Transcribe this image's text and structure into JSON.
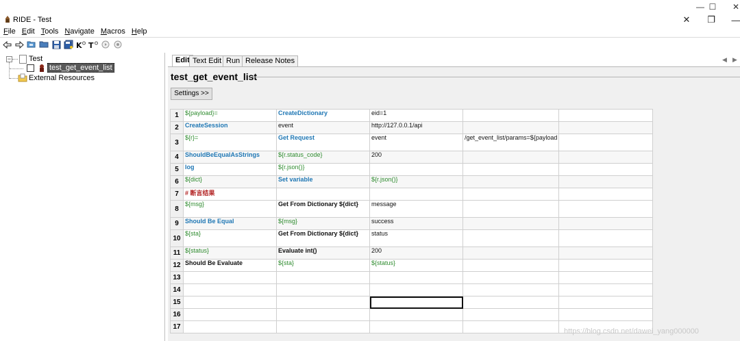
{
  "window": {
    "title": "RIDE - Test"
  },
  "menu": [
    {
      "key": "F",
      "rest": "ile"
    },
    {
      "key": "E",
      "rest": "dit"
    },
    {
      "key": "T",
      "rest": "ools"
    },
    {
      "key": "N",
      "rest": "avigate"
    },
    {
      "key": "M",
      "rest": "acros"
    },
    {
      "key": "H",
      "rest": "elp"
    }
  ],
  "tree": {
    "root": "Test",
    "test_case": "test_get_event_list",
    "external": "External Resources"
  },
  "tabs": [
    "Edit",
    "Text Edit",
    "Run",
    "Release Notes"
  ],
  "editor": {
    "title": "test_get_event_list",
    "settings_label": "Settings >>"
  },
  "rows": [
    {
      "n": "1",
      "c": [
        {
          "t": "${payload}=",
          "s": "var"
        },
        {
          "t": "CreateDictionary",
          "s": "kw"
        },
        {
          "t": "eid=1",
          "s": "plain"
        },
        {
          "t": "",
          "s": "plain"
        },
        {
          "t": "",
          "s": "plain"
        }
      ]
    },
    {
      "n": "2",
      "c": [
        {
          "t": "CreateSession",
          "s": "kw"
        },
        {
          "t": "event",
          "s": "plain"
        },
        {
          "t": "http://127.0.0.1/api",
          "s": "plain"
        },
        {
          "t": "",
          "s": "plain"
        },
        {
          "t": "",
          "s": "plain"
        }
      ]
    },
    {
      "n": "3",
      "c": [
        {
          "t": "${r}=",
          "s": "var"
        },
        {
          "t": "Get Request",
          "s": "kw"
        },
        {
          "t": "event",
          "s": "plain"
        },
        {
          "t": "/get_event_list/params=${payload",
          "s": "plain"
        },
        {
          "t": "",
          "s": "plain"
        }
      ]
    },
    {
      "n": "4",
      "c": [
        {
          "t": "ShouldBeEqualAsStrings",
          "s": "kw"
        },
        {
          "t": "${r.status_code}",
          "s": "var"
        },
        {
          "t": "200",
          "s": "plain"
        },
        {
          "t": "",
          "s": "plain"
        },
        {
          "t": "",
          "s": "plain"
        }
      ]
    },
    {
      "n": "5",
      "c": [
        {
          "t": "log",
          "s": "kw"
        },
        {
          "t": "${r.json()}",
          "s": "var"
        },
        {
          "t": "",
          "s": "plain"
        },
        {
          "t": "",
          "s": "plain"
        },
        {
          "t": "",
          "s": "plain"
        }
      ]
    },
    {
      "n": "6",
      "c": [
        {
          "t": "${dict}",
          "s": "var"
        },
        {
          "t": "Set variable",
          "s": "kw"
        },
        {
          "t": "${r.json()}",
          "s": "var"
        },
        {
          "t": "",
          "s": "plain"
        },
        {
          "t": "",
          "s": "plain"
        }
      ]
    },
    {
      "n": "7",
      "c": [
        {
          "t": "# 断言结果",
          "s": "comment"
        },
        {
          "t": "",
          "s": "plain"
        },
        {
          "t": "",
          "s": "plain"
        },
        {
          "t": "",
          "s": "plain"
        },
        {
          "t": "",
          "s": "plain"
        }
      ]
    },
    {
      "n": "8",
      "c": [
        {
          "t": "${msg}",
          "s": "var"
        },
        {
          "t": "Get From Dictionary ${dict}",
          "s": "bold"
        },
        {
          "t": "message",
          "s": "plain"
        },
        {
          "t": "",
          "s": "plain"
        },
        {
          "t": "",
          "s": "plain"
        }
      ]
    },
    {
      "n": "9",
      "c": [
        {
          "t": "Should Be Equal",
          "s": "kw"
        },
        {
          "t": "${msg}",
          "s": "var"
        },
        {
          "t": "success",
          "s": "plain"
        },
        {
          "t": "",
          "s": "plain"
        },
        {
          "t": "",
          "s": "plain"
        }
      ]
    },
    {
      "n": "10",
      "c": [
        {
          "t": "${sta}",
          "s": "var"
        },
        {
          "t": "Get From Dictionary ${dict}",
          "s": "bold"
        },
        {
          "t": "status",
          "s": "plain"
        },
        {
          "t": "",
          "s": "plain"
        },
        {
          "t": "",
          "s": "plain"
        }
      ]
    },
    {
      "n": "11",
      "c": [
        {
          "t": "${status}",
          "s": "var"
        },
        {
          "t": "Evaluate int()",
          "s": "bold"
        },
        {
          "t": "200",
          "s": "plain"
        },
        {
          "t": "",
          "s": "plain"
        },
        {
          "t": "",
          "s": "plain"
        }
      ]
    },
    {
      "n": "12",
      "c": [
        {
          "t": "Should Be Evaluate",
          "s": "bold"
        },
        {
          "t": "${sta}",
          "s": "var"
        },
        {
          "t": "${status}",
          "s": "var"
        },
        {
          "t": "",
          "s": "plain"
        },
        {
          "t": "",
          "s": "plain"
        }
      ]
    },
    {
      "n": "13",
      "c": [
        {
          "t": "",
          "s": "plain"
        },
        {
          "t": "",
          "s": "plain"
        },
        {
          "t": "",
          "s": "plain"
        },
        {
          "t": "",
          "s": "plain"
        },
        {
          "t": "",
          "s": "plain"
        }
      ]
    },
    {
      "n": "14",
      "c": [
        {
          "t": "",
          "s": "plain"
        },
        {
          "t": "",
          "s": "plain"
        },
        {
          "t": "",
          "s": "plain"
        },
        {
          "t": "",
          "s": "plain"
        },
        {
          "t": "",
          "s": "plain"
        }
      ]
    },
    {
      "n": "15",
      "c": [
        {
          "t": "",
          "s": "plain"
        },
        {
          "t": "",
          "s": "plain"
        },
        {
          "t": "",
          "s": "plain"
        },
        {
          "t": "",
          "s": "plain"
        },
        {
          "t": "",
          "s": "plain"
        }
      ]
    },
    {
      "n": "16",
      "c": [
        {
          "t": "",
          "s": "plain"
        },
        {
          "t": "",
          "s": "plain"
        },
        {
          "t": "",
          "s": "plain"
        },
        {
          "t": "",
          "s": "plain"
        },
        {
          "t": "",
          "s": "plain"
        }
      ]
    },
    {
      "n": "17",
      "c": [
        {
          "t": "",
          "s": "plain"
        },
        {
          "t": "",
          "s": "plain"
        },
        {
          "t": "",
          "s": "plain"
        },
        {
          "t": "",
          "s": "plain"
        },
        {
          "t": "",
          "s": "plain"
        }
      ]
    }
  ],
  "watermark": "https://blog.csdn.net/dawei_yang000000"
}
